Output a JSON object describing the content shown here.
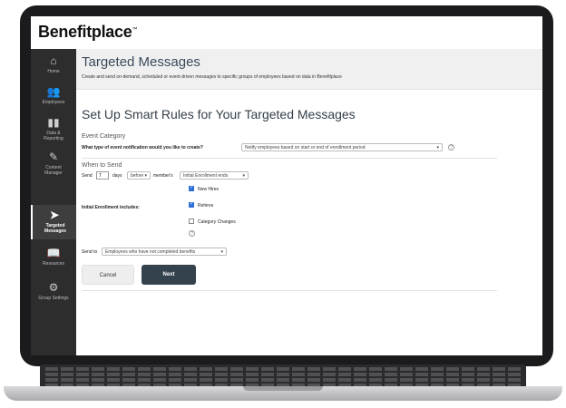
{
  "app": {
    "logo": "Benefitplace",
    "logo_mark": "™"
  },
  "sidebar": {
    "items": [
      {
        "label": "Home",
        "icon": "home-icon",
        "glyph": "⌂"
      },
      {
        "label": "Employees",
        "icon": "employees-icon",
        "glyph": "👥"
      },
      {
        "label": "Data & Reporting",
        "icon": "chart-icon",
        "glyph": "▮▮"
      },
      {
        "label": "Content Manager",
        "icon": "edit-icon",
        "glyph": "✎"
      },
      {
        "label": "Targeted Messages",
        "icon": "paper-plane-icon",
        "glyph": "➤",
        "active": true
      },
      {
        "label": "Resources",
        "icon": "book-icon",
        "glyph": "📖"
      },
      {
        "label": "Group Settings",
        "icon": "gear-icon",
        "glyph": "⚙"
      }
    ]
  },
  "header": {
    "title": "Targeted Messages",
    "subtitle": "Create and send on-demand, scheduled or event-driven messages to specific groups of employees based on data in Benefitplace"
  },
  "form": {
    "section_title": "Set Up Smart Rules for Your Targeted Messages",
    "event_category": {
      "heading": "Event Category",
      "question": "What type of event notification would you like to create?",
      "selected": "Notify employees based on start or end of enrollment period"
    },
    "when_to_send": {
      "heading": "When to Send",
      "send_label": "Send",
      "days_value": "7",
      "days_label": "days",
      "relation_selected": "before",
      "member_label": "member's",
      "event_selected": "Initial Enrollment ends"
    },
    "includes": {
      "label": "Initial Enrollment includes:",
      "options": [
        {
          "label": "New Hires",
          "checked": true
        },
        {
          "label": "Rehires",
          "checked": true
        },
        {
          "label": "Category Changes",
          "checked": false
        }
      ]
    },
    "send_to": {
      "label": "Send to",
      "selected": "Employees who have not completed benefits"
    },
    "buttons": {
      "cancel": "Cancel",
      "next": "Next"
    },
    "help_glyph": "?"
  },
  "colors": {
    "sidebar_bg": "#2d2d2d",
    "primary_button": "#34424d",
    "checkbox_accent": "#2f6fd8",
    "header_bg": "#f0f0f0"
  }
}
